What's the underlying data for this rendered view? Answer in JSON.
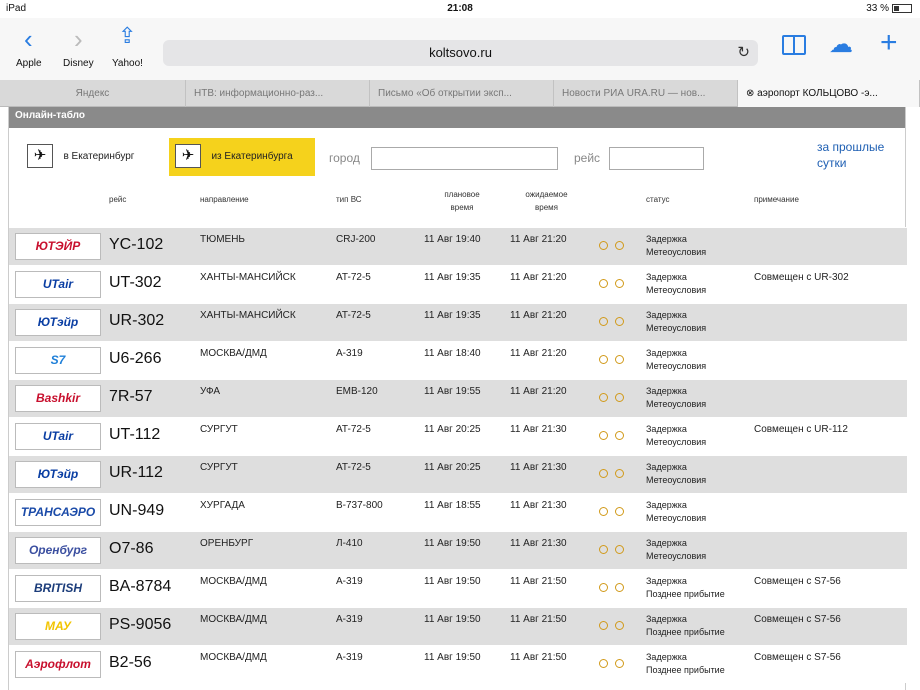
{
  "statusbar": {
    "device": "iPad",
    "time": "21:08",
    "battery": "33 %"
  },
  "browser": {
    "url": "koltsovo.ru",
    "favorites": [
      "Apple",
      "Disney",
      "Yahoo!"
    ],
    "tabs": [
      {
        "label": "Яндекс"
      },
      {
        "label": "НТВ: информационно-раз..."
      },
      {
        "label": "Письмо «Об открытии эксп..."
      },
      {
        "label": "Новости РИА URA.RU — нов..."
      },
      {
        "label": "аэропорт КОЛЬЦОВО -э..."
      }
    ]
  },
  "board": {
    "title": "Онлайн-табло",
    "to_city_label": "в Екатеринбург",
    "from_city_label": "из Екатеринбурга",
    "city_label": "город",
    "flight_label": "рейс",
    "prev_days": "за прошлые сутки",
    "columns": {
      "flight": "рейс",
      "destination": "направление",
      "aircraft": "тип ВС",
      "planned": "плановое время",
      "expected": "ожидаемое время",
      "status": "статус",
      "note": "примечание"
    },
    "flights": [
      {
        "airline": "ЮТЭЙР",
        "logo_color": "#c8102e",
        "flight": "YC-102",
        "destination": "ТЮМЕНЬ",
        "aircraft": "CRJ-200",
        "planned": "11 Авг 19:40",
        "expected": "11 Авг 21:20",
        "status": "Задержка",
        "reason": "Метеоусловия",
        "note": ""
      },
      {
        "airline": "UTair",
        "logo_color": "#0a3ea3",
        "flight": "UT-302",
        "destination": "ХАНТЫ-МАНСИЙСК",
        "aircraft": "AT-72-5",
        "planned": "11 Авг 19:35",
        "expected": "11 Авг 21:20",
        "status": "Задержка",
        "reason": "Метеоусловия",
        "note": "Совмещен с UR-302"
      },
      {
        "airline": "ЮТэйр",
        "logo_color": "#0a3ea3",
        "flight": "UR-302",
        "destination": "ХАНТЫ-МАНСИЙСК",
        "aircraft": "AT-72-5",
        "planned": "11 Авг 19:35",
        "expected": "11 Авг 21:20",
        "status": "Задержка",
        "reason": "Метеоусловия",
        "note": ""
      },
      {
        "airline": "S7",
        "logo_color": "#1e7fd8",
        "flight": "U6-266",
        "destination": "МОСКВА/ДМД",
        "aircraft": "A-319",
        "planned": "11 Авг 18:40",
        "expected": "11 Авг 21:20",
        "status": "Задержка",
        "reason": "Метеоусловия",
        "note": ""
      },
      {
        "airline": "Bashkir",
        "logo_color": "#c8102e",
        "flight": "7R-57",
        "destination": "УФА",
        "aircraft": "EMB-120",
        "planned": "11 Авг 19:55",
        "expected": "11 Авг 21:20",
        "status": "Задержка",
        "reason": "Метеоусловия",
        "note": ""
      },
      {
        "airline": "UTair",
        "logo_color": "#0a3ea3",
        "flight": "UT-112",
        "destination": "СУРГУТ",
        "aircraft": "AT-72-5",
        "planned": "11 Авг 20:25",
        "expected": "11 Авг 21:30",
        "status": "Задержка",
        "reason": "Метеоусловия",
        "note": "Совмещен с UR-112"
      },
      {
        "airline": "ЮТэйр",
        "logo_color": "#0a3ea3",
        "flight": "UR-112",
        "destination": "СУРГУТ",
        "aircraft": "AT-72-5",
        "planned": "11 Авг 20:25",
        "expected": "11 Авг 21:30",
        "status": "Задержка",
        "reason": "Метеоусловия",
        "note": ""
      },
      {
        "airline": "ТРАНСАЭРО",
        "logo_color": "#1a4aa8",
        "flight": "UN-949",
        "destination": "ХУРГАДА",
        "aircraft": "B-737-800",
        "planned": "11 Авг 18:55",
        "expected": "11 Авг 21:30",
        "status": "Задержка",
        "reason": "Метеоусловия",
        "note": ""
      },
      {
        "airline": "Оренбург",
        "logo_color": "#3b4fa0",
        "flight": "O7-86",
        "destination": "ОРЕНБУРГ",
        "aircraft": "Л-410",
        "planned": "11 Авг 19:50",
        "expected": "11 Авг 21:30",
        "status": "Задержка",
        "reason": "Метеоусловия",
        "note": ""
      },
      {
        "airline": "BRITISH AIRWAYS",
        "logo_color": "#1b3c7a",
        "flight": "BA-8784",
        "destination": "МОСКВА/ДМД",
        "aircraft": "A-319",
        "planned": "11 Авг 19:50",
        "expected": "11 Авг 21:50",
        "status": "Задержка",
        "reason": "Позднее прибытие",
        "note": "Совмещен с S7-56"
      },
      {
        "airline": "МАУ",
        "logo_color": "#f2c400",
        "flight": "PS-9056",
        "destination": "МОСКВА/ДМД",
        "aircraft": "A-319",
        "planned": "11 Авг 19:50",
        "expected": "11 Авг 21:50",
        "status": "Задержка",
        "reason": "Позднее прибытие",
        "note": "Совмещен с S7-56"
      },
      {
        "airline": "Аэрофлот",
        "logo_color": "#c8102e",
        "flight": "B2-56",
        "destination": "МОСКВА/ДМД",
        "aircraft": "A-319",
        "planned": "11 Авг 19:50",
        "expected": "11 Авг 21:50",
        "status": "Задержка",
        "reason": "Позднее прибытие",
        "note": "Совмещен с S7-56"
      }
    ]
  }
}
